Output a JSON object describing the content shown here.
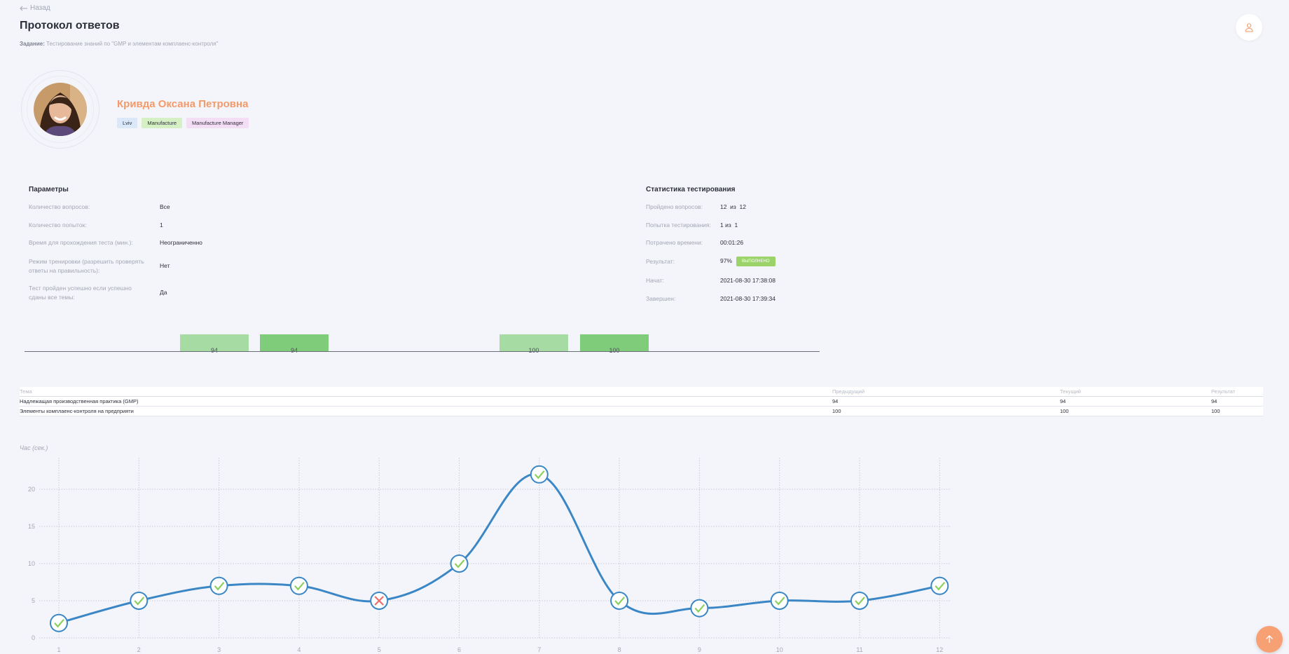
{
  "header": {
    "back_label": "Назад",
    "title": "Протокол ответов",
    "task_label": "Задание:",
    "task_value": "Тестирование знаний по \"GMP и элементам комплаенс-контроля\""
  },
  "user": {
    "name": "Кривда Оксана Петровна",
    "tags": [
      {
        "label": "Lviv",
        "color": "#dbe8fa"
      },
      {
        "label": "Manufacture",
        "color": "#d4f0c4"
      },
      {
        "label": "Manufacture Manager",
        "color": "#f3def5"
      }
    ]
  },
  "params": {
    "heading": "Параметры",
    "rows": [
      {
        "label": "Количество вопросов:",
        "value": "Все"
      },
      {
        "label": "Количество попыток:",
        "value": "1"
      },
      {
        "label": "Время для прохождения теста (мин.):",
        "value": "Неограниченно"
      },
      {
        "label": "Режим тренировки (разрешить проверять ответы на правильность):",
        "value": "Нет"
      },
      {
        "label": "Тест пройден успешно если успешно сданы все темы:",
        "value": "Да"
      }
    ]
  },
  "stats": {
    "heading": "Статистика тестирования",
    "rows": [
      {
        "label": "Пройдено вопросов:",
        "value": "12  из  12"
      },
      {
        "label": "Попытка тестирования:",
        "value": "1 из  1"
      },
      {
        "label": "Потрачено времени:",
        "value": "00:01:26"
      },
      {
        "label": "Результат:",
        "value": "97%"
      },
      {
        "label": "Начат:",
        "value": "2021-08-30 17:38:08"
      },
      {
        "label": "Завершен:",
        "value": "2021-08-30 17:39:34"
      }
    ],
    "result_badge": "выполнено"
  },
  "bar_chart": {
    "bars": [
      {
        "value": "94",
        "color": "#a6dca4"
      },
      {
        "value": "94",
        "color": "#7fcd7b"
      },
      {
        "value": "100",
        "color": "#a6dca4"
      },
      {
        "value": "100",
        "color": "#7fcd7b"
      }
    ]
  },
  "table": {
    "headers": [
      "Тема",
      "Предыдущий",
      "Текущий",
      "Результат"
    ],
    "rows": [
      [
        "Надлежащая производственная практика (GMP)",
        "94",
        "94",
        "94"
      ],
      [
        "Элементы комплаенс-контроля на предприяти",
        "100",
        "100",
        "100"
      ]
    ]
  },
  "chart_data": {
    "type": "line",
    "ylabel": "Час (сек.)",
    "x": [
      1,
      2,
      3,
      4,
      5,
      6,
      7,
      8,
      9,
      10,
      11,
      12
    ],
    "y": [
      2,
      5,
      7,
      7,
      5,
      10,
      22,
      5,
      4,
      5,
      5,
      7
    ],
    "correct": [
      true,
      true,
      true,
      true,
      false,
      true,
      true,
      true,
      true,
      true,
      true,
      true
    ],
    "yticks": [
      0,
      5,
      10,
      15,
      20
    ],
    "ylim": [
      0,
      24
    ],
    "grid": true,
    "line_color": "#3b87c6",
    "correct_color": "#8bcf5c",
    "wrong_color": "#ee6b6b"
  }
}
